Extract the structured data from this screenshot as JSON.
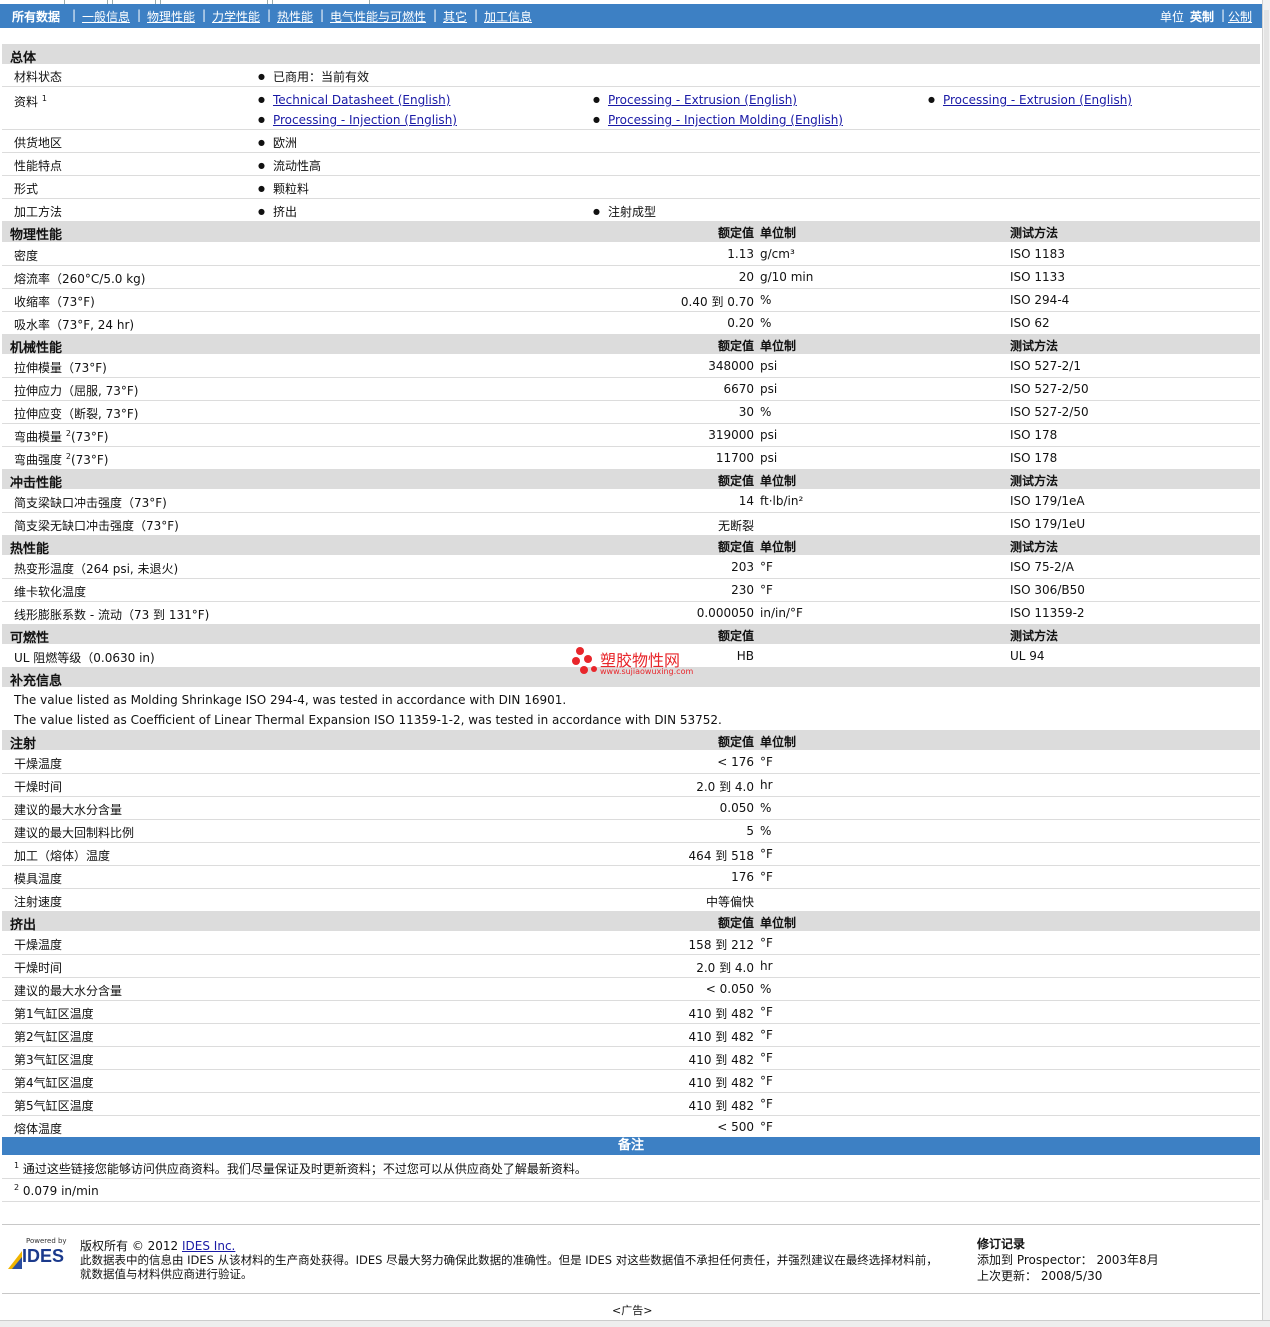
{
  "nav": {
    "tabs": [
      "所有数据",
      "一般信息",
      "物理性能",
      "力学性能",
      "热性能",
      "电气性能与可燃性",
      "其它",
      "加工信息"
    ],
    "unit_label": "单位",
    "unit_english": "英制",
    "unit_metric": "公制"
  },
  "general": {
    "title": "总体",
    "status_label": "材料状态",
    "status_value": "已商用：当前有效",
    "docs_label": "资料",
    "docs_sup": "1",
    "docs": [
      "Technical Datasheet (English)",
      "Processing - Extrusion (English)",
      "Processing - Extrusion (English)",
      "Processing - Injection (English)",
      "Processing - Injection Molding (English)"
    ],
    "region_label": "供货地区",
    "region_value": "欧洲",
    "features_label": "性能特点",
    "features_value": "流动性高",
    "form_label": "形式",
    "form_value": "颗粒料",
    "method_label": "加工方法",
    "method_values": [
      "挤出",
      "注射成型"
    ]
  },
  "col_headers": {
    "value": "额定值",
    "unit": "单位制",
    "test": "测试方法"
  },
  "physical": {
    "title": "物理性能",
    "rows": [
      {
        "label": "密度",
        "value": "1.13",
        "unit": "g/cm³",
        "test": "ISO 1183"
      },
      {
        "label": "熔流率（260°C/5.0 kg)",
        "value": "20",
        "unit": "g/10 min",
        "test": "ISO 1133"
      },
      {
        "label": "收缩率（73°F)",
        "value": "0.40 到  0.70",
        "unit": "%",
        "test": "ISO 294-4"
      },
      {
        "label": "吸水率（73°F, 24 hr)",
        "value": "0.20",
        "unit": "%",
        "test": "ISO 62"
      }
    ]
  },
  "mechanical": {
    "title": "机械性能",
    "rows": [
      {
        "label": "拉伸模量（73°F)",
        "value": "348000",
        "unit": "psi",
        "test": "ISO 527-2/1"
      },
      {
        "label": "拉伸应力（屈服, 73°F)",
        "value": "6670",
        "unit": "psi",
        "test": "ISO 527-2/50"
      },
      {
        "label": "拉伸应变（断裂, 73°F)",
        "value": "30",
        "unit": "%",
        "test": "ISO 527-2/50"
      },
      {
        "label": "弯曲模量",
        "sup": "2",
        "label2": "(73°F)",
        "value": "319000",
        "unit": "psi",
        "test": "ISO 178"
      },
      {
        "label": "弯曲强度",
        "sup": "2",
        "label2": "(73°F)",
        "value": "11700",
        "unit": "psi",
        "test": "ISO 178"
      }
    ]
  },
  "impact": {
    "title": "冲击性能",
    "rows": [
      {
        "label": "简支梁缺口冲击强度（73°F)",
        "value": "14",
        "unit": "ft·lb/in²",
        "test": "ISO 179/1eA"
      },
      {
        "label": "简支梁无缺口冲击强度（73°F)",
        "value": "无断裂",
        "unit": "",
        "test": "ISO 179/1eU"
      }
    ]
  },
  "thermal": {
    "title": "热性能",
    "rows": [
      {
        "label": "热变形温度（264 psi, 未退火)",
        "value": "203",
        "unit": "°F",
        "test": "ISO 75-2/A"
      },
      {
        "label": "维卡软化温度",
        "value": "230",
        "unit": "°F",
        "test": "ISO 306/B50"
      },
      {
        "label": "线形膨胀系数 - 流动（73 到  131°F)",
        "value": "0.000050",
        "unit": "in/in/°F",
        "test": "ISO 11359-2"
      }
    ]
  },
  "flammability": {
    "title": "可燃性",
    "rows": [
      {
        "label": "UL 阻燃等级（0.0630 in)",
        "value": "HB",
        "unit": "",
        "test": "UL 94"
      }
    ]
  },
  "supplement": {
    "title": "补充信息",
    "lines": [
      "The value listed as Molding Shrinkage ISO 294-4, was tested in accordance with DIN 16901.",
      "The value listed as Coefficient of Linear Thermal Expansion ISO 11359-1-2, was tested in accordance with DIN 53752."
    ]
  },
  "injection": {
    "title": "注射",
    "rows": [
      {
        "label": "干燥温度",
        "value": "< 176",
        "unit": "°F"
      },
      {
        "label": "干燥时间",
        "value": "2.0 到  4.0",
        "unit": "hr"
      },
      {
        "label": "建议的最大水分含量",
        "value": "0.050",
        "unit": "%"
      },
      {
        "label": "建议的最大回制料比例",
        "value": "5",
        "unit": "%"
      },
      {
        "label": "加工（熔体）温度",
        "value": "464 到  518",
        "unit": "°F"
      },
      {
        "label": "模具温度",
        "value": "176",
        "unit": "°F"
      },
      {
        "label": "注射速度",
        "value": "中等偏快",
        "unit": ""
      }
    ]
  },
  "extrusion": {
    "title": "挤出",
    "rows": [
      {
        "label": "干燥温度",
        "value": "158 到  212",
        "unit": "°F"
      },
      {
        "label": "干燥时间",
        "value": "2.0 到  4.0",
        "unit": "hr"
      },
      {
        "label": "建议的最大水分含量",
        "value": "< 0.050",
        "unit": "%"
      },
      {
        "label": "第1气缸区温度",
        "value": "410 到  482",
        "unit": "°F"
      },
      {
        "label": "第2气缸区温度",
        "value": "410 到  482",
        "unit": "°F"
      },
      {
        "label": "第3气缸区温度",
        "value": "410 到  482",
        "unit": "°F"
      },
      {
        "label": "第4气缸区温度",
        "value": "410 到  482",
        "unit": "°F"
      },
      {
        "label": "第5气缸区温度",
        "value": "410 到  482",
        "unit": "°F"
      },
      {
        "label": "熔体温度",
        "value": "< 500",
        "unit": "°F"
      }
    ]
  },
  "notes": {
    "title": "备注",
    "items": [
      {
        "sup": "1",
        "text": "通过这些链接您能够访问供应商资料。我们尽量保证及时更新资料；不过您可以从供应商处了解最新资料。"
      },
      {
        "sup": "2",
        "text": "0.079 in/min"
      }
    ]
  },
  "footer": {
    "powered_by": "Powered by",
    "logo_text": "IDES",
    "copyright": "版权所有 © 2012",
    "company": "IDES Inc.",
    "disclaimer_1": "此数据表中的信息由 IDES 从该材料的生产商处获得。IDES 尽最大努力确保此数据的准确性。但是 IDES 对这些数据值不承担任何责任，并强烈建议在最终选择材料前，",
    "disclaimer_2": "就数据值与材料供应商进行验证。",
    "rev_title": "修订记录",
    "added_label": "添加到 Prospector：",
    "added_date": "2003年8月",
    "updated_label": "上次更新：",
    "updated_date": "2008/5/30",
    "ad": "<广告>"
  },
  "watermark": {
    "cn": "塑胶物性网",
    "url": "www.sujiaowuxing.com"
  },
  "colors": {
    "nav_bg": "#3d80c4",
    "header_bg": "#dcdcdc",
    "link": "#1a1aa6",
    "watermark": "#e8262b"
  }
}
